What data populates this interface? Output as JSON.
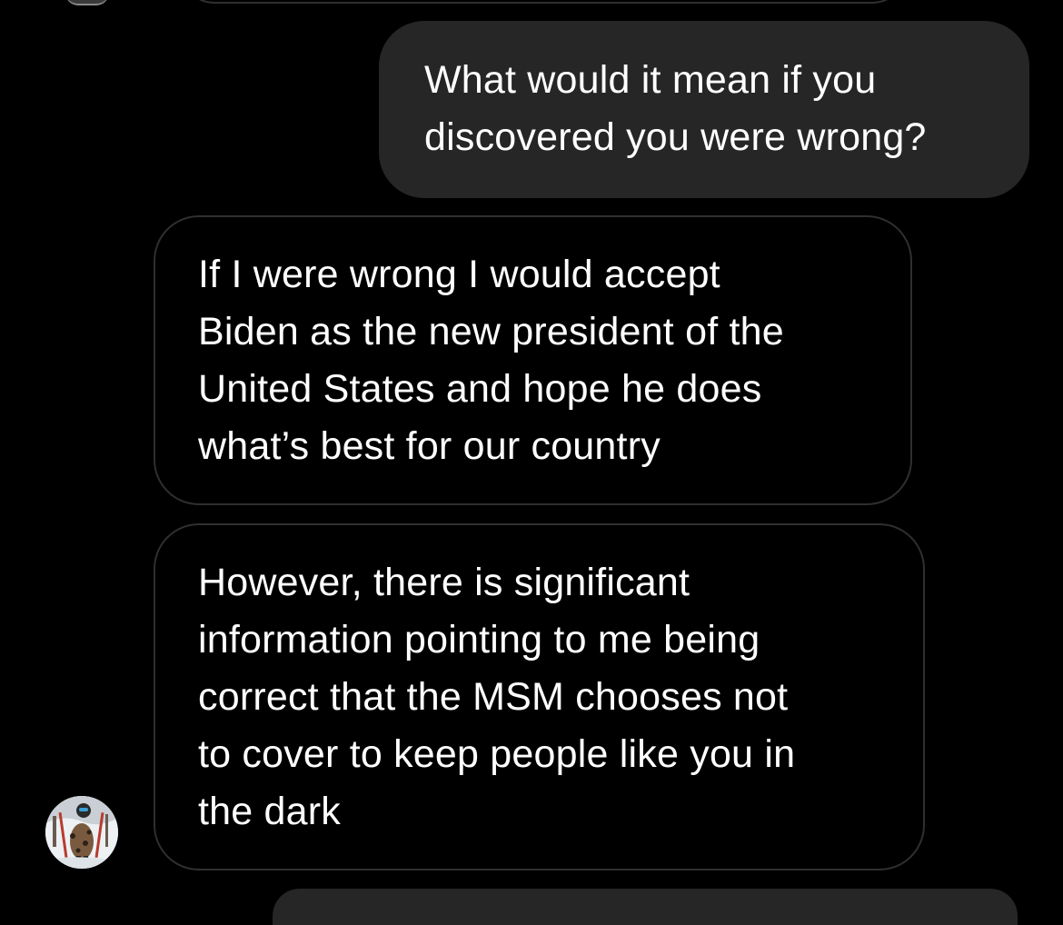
{
  "app": {
    "background_color": "#000000",
    "sent_bubble_color": "#262626",
    "received_bubble_border_color": "#2f2f2f",
    "text_color": "#ffffff"
  },
  "thread": {
    "messages": [
      {
        "direction": "sent",
        "lines": [
          "What would it mean if you",
          "discovered you were wrong?"
        ]
      },
      {
        "direction": "received",
        "lines": [
          "If I were wrong I would accept",
          "Biden as the new president of the",
          "United States and hope he does",
          "what’s best for our country"
        ]
      },
      {
        "direction": "received",
        "lines": [
          "However, there is significant",
          "information pointing to me being",
          "correct that the MSM chooses not",
          "to cover to keep people like you in",
          "the dark"
        ]
      }
    ],
    "sender_avatar": {
      "icon": "profile-photo-avatar"
    }
  }
}
